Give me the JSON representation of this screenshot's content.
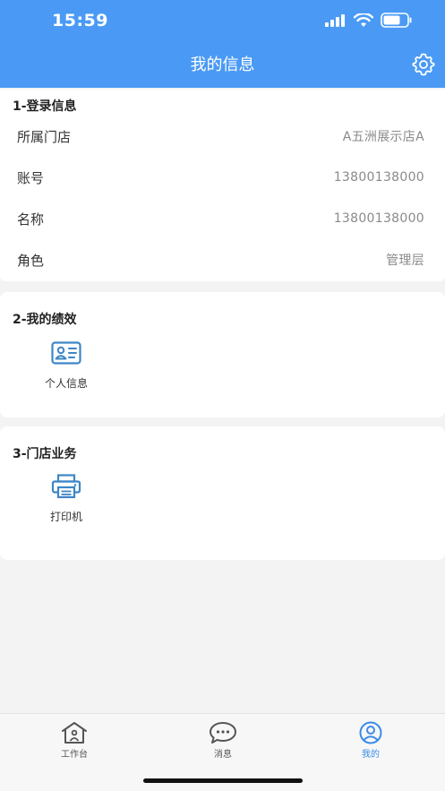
{
  "status_bar": {
    "time": "15:59"
  },
  "navbar": {
    "title": "我的信息"
  },
  "login_section": {
    "title": "1-登录信息",
    "rows": [
      {
        "label": "所属门店",
        "value": "A五洲展示店A"
      },
      {
        "label": "账号",
        "value": "13800138000"
      },
      {
        "label": "名称",
        "value": "13800138000"
      },
      {
        "label": "角色",
        "value": "管理层"
      }
    ]
  },
  "performance_section": {
    "title": "2-我的绩效",
    "items": [
      {
        "label": "个人信息",
        "icon": "id-card-icon"
      }
    ]
  },
  "store_section": {
    "title": "3-门店业务",
    "items": [
      {
        "label": "打印机",
        "icon": "printer-icon"
      }
    ]
  },
  "tabbar": {
    "tabs": [
      {
        "label": "工作台",
        "icon": "home-icon",
        "active": false
      },
      {
        "label": "消息",
        "icon": "message-icon",
        "active": false
      },
      {
        "label": "我的",
        "icon": "user-icon",
        "active": true
      }
    ]
  },
  "colors": {
    "primary": "#4a9af5",
    "active_tab": "#3b8ce8",
    "icon_blue": "#3d86c6"
  }
}
